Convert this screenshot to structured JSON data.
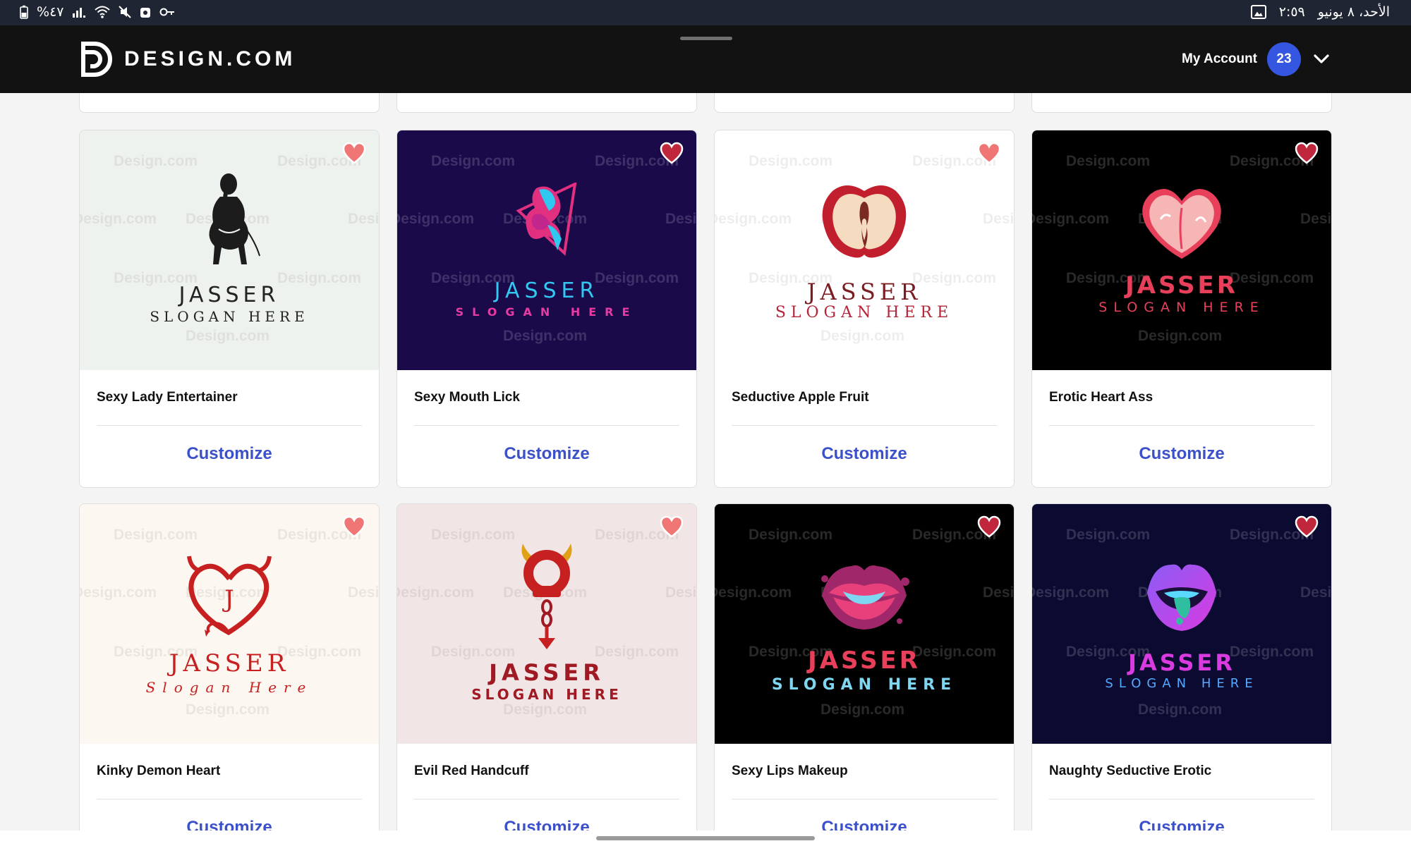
{
  "status_bar": {
    "battery": "%٤٧",
    "time": "٢:٥٩",
    "date": "الأحد، ٨ يونيو"
  },
  "header": {
    "brand": "DESIGN.COM",
    "account_label": "My Account",
    "badge_count": "23"
  },
  "watermark_text": "Design.com",
  "logo_text": {
    "brand": "JASSER",
    "slogan_caps": "SLOGAN HERE",
    "slogan_title": "Slogan Here"
  },
  "cards": [
    {
      "title": "Sexy Lady Entertainer",
      "action": "Customize",
      "bg": "#eef2ee",
      "brand_color": "#222222",
      "slogan_color": "#222222",
      "heart_color": "#f07575",
      "graphic": "silhouette-woman"
    },
    {
      "title": "Sexy Mouth Lick",
      "action": "Customize",
      "bg": "#1a0a4a",
      "brand_color": "#33c8f2",
      "slogan_color": "#e83aa3",
      "heart_color": "#c0273c",
      "graphic": "mouth-lick"
    },
    {
      "title": "Seductive Apple Fruit",
      "action": "Customize",
      "bg": "#ffffff",
      "brand_color": "#7a1c22",
      "slogan_color": "#b5253a",
      "heart_color": "#f07575",
      "graphic": "apple"
    },
    {
      "title": "Erotic Heart Ass",
      "action": "Customize",
      "bg": "#000000",
      "brand_color": "#e8405a",
      "slogan_color": "#e8405a",
      "heart_color": "#c0273c",
      "graphic": "heart-ass"
    },
    {
      "title": "Kinky Demon Heart",
      "action": "Customize",
      "bg": "#fdf7f1",
      "brand_color": "#c62020",
      "slogan_color": "#c62020",
      "heart_color": "#f07575",
      "graphic": "demon-heart"
    },
    {
      "title": "Evil Red Handcuff",
      "action": "Customize",
      "bg": "#f1e5e5",
      "brand_color": "#a01a24",
      "slogan_color": "#a01a24",
      "heart_color": "#f07575",
      "graphic": "handcuff"
    },
    {
      "title": "Sexy Lips Makeup",
      "action": "Customize",
      "bg": "#000000",
      "brand_color": "#e8405a",
      "slogan_color": "#7fd6f0",
      "heart_color": "#c0273c",
      "graphic": "lips-makeup"
    },
    {
      "title": "Naughty Seductive Erotic",
      "action": "Customize",
      "bg": "#0b0a30",
      "brand_color": "#d93be0",
      "slogan_color": "#55a8ff",
      "heart_color": "#c0273c",
      "graphic": "lips-tongue"
    }
  ]
}
